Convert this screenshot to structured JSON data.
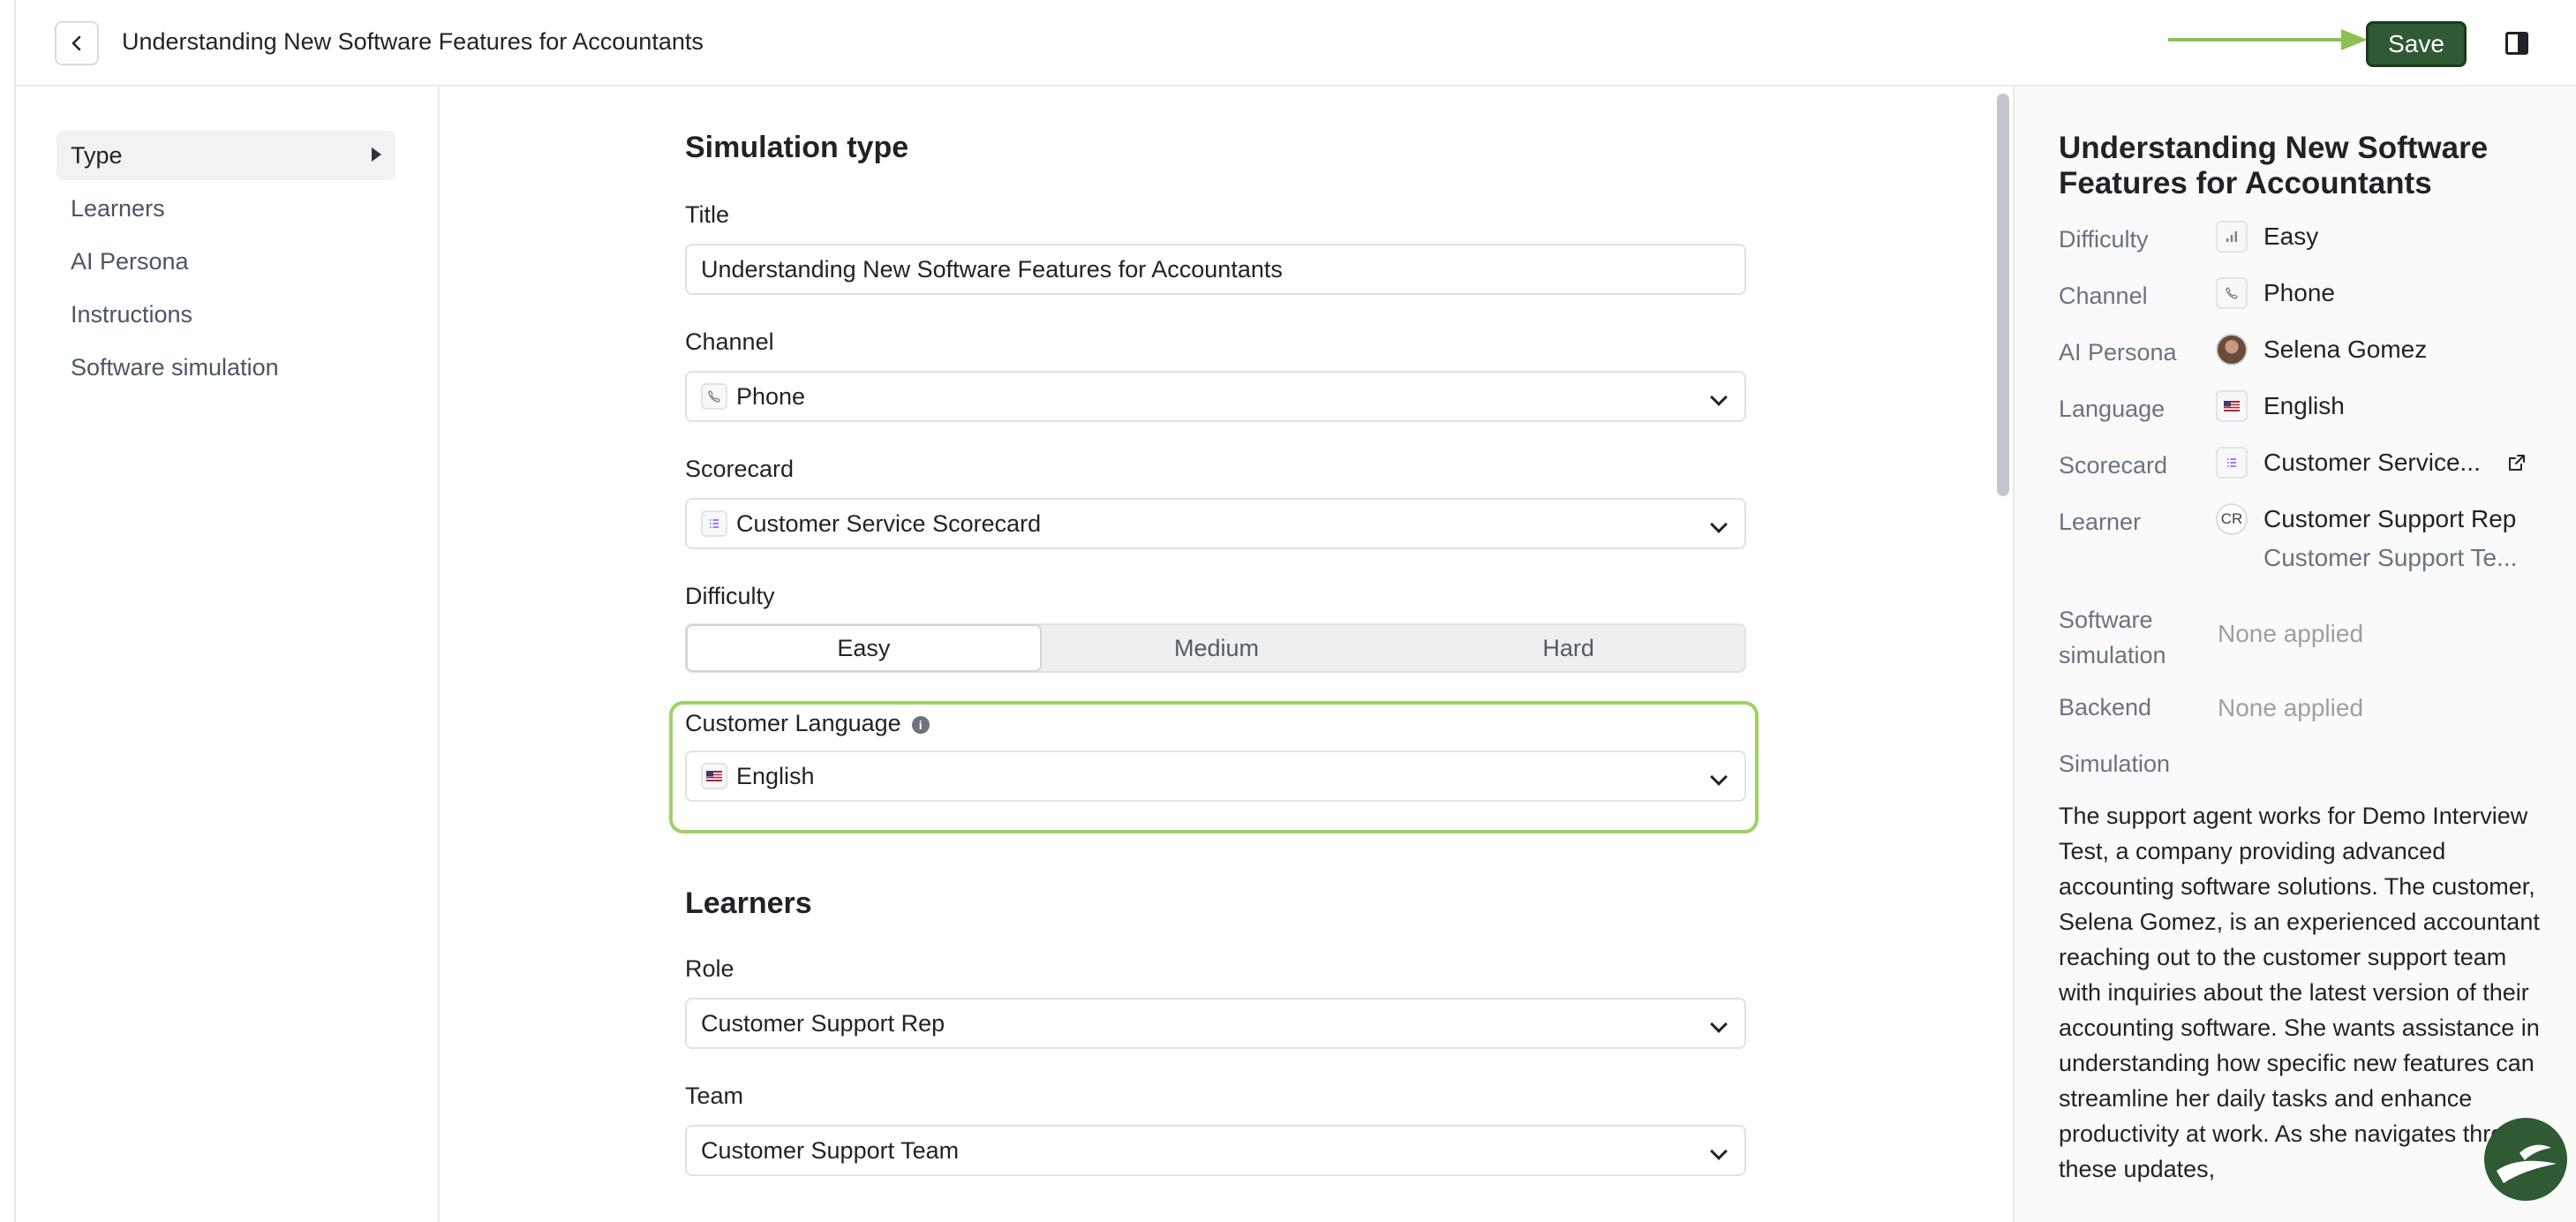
{
  "header": {
    "title": "Understanding New Software Features for Accountants",
    "save_label": "Save"
  },
  "nav": {
    "items": [
      {
        "label": "Type",
        "active": true
      },
      {
        "label": "Learners"
      },
      {
        "label": "AI Persona"
      },
      {
        "label": "Instructions"
      },
      {
        "label": "Software simulation"
      }
    ]
  },
  "form": {
    "section_type": "Simulation type",
    "title_label": "Title",
    "title_value": "Understanding New Software Features for Accountants",
    "channel_label": "Channel",
    "channel_value": "Phone",
    "scorecard_label": "Scorecard",
    "scorecard_value": "Customer Service Scorecard",
    "difficulty_label": "Difficulty",
    "difficulty_options": [
      "Easy",
      "Medium",
      "Hard"
    ],
    "difficulty_selected": "Easy",
    "language_label": "Customer Language",
    "language_value": "English",
    "section_learners": "Learners",
    "role_label": "Role",
    "role_value": "Customer Support Rep",
    "team_label": "Team",
    "team_value": "Customer Support Team"
  },
  "summary": {
    "title": "Understanding New Software Features for Accountants",
    "difficulty_label": "Difficulty",
    "difficulty_value": "Easy",
    "channel_label": "Channel",
    "channel_value": "Phone",
    "persona_label": "AI Persona",
    "persona_value": "Selena Gomez",
    "language_label": "Language",
    "language_value": "English",
    "scorecard_label": "Scorecard",
    "scorecard_value": "Customer Service...",
    "learner_label": "Learner",
    "learner_badge": "CR",
    "learner_role": "Customer Support Rep",
    "learner_team": "Customer Support Te...",
    "software_label": "Software simulation",
    "software_value": "None applied",
    "backend_label": "Backend",
    "backend_value": "None applied",
    "simulation_label": "Simulation",
    "simulation_text": "The support agent works for Demo Interview Test, a company providing advanced accounting software solutions. The customer, Selena Gomez, is an experienced accountant reaching out to the customer support team with inquiries about the latest version of their accounting software. She wants assistance in understanding how specific new features can streamline her daily tasks and enhance productivity at work. As she navigates through these updates,"
  },
  "colors": {
    "save_button": "#2f5a33",
    "highlight_border": "#9ed264",
    "arrow": "#8cc152"
  },
  "icons": [
    "back-chevron-icon",
    "arrow-right-icon",
    "panel-toggle-icon",
    "phone-icon",
    "scorecard-icon",
    "flag-us-icon",
    "info-icon",
    "chevron-down-icon",
    "difficulty-bars-icon",
    "external-link-icon",
    "assistant-logo-icon"
  ]
}
